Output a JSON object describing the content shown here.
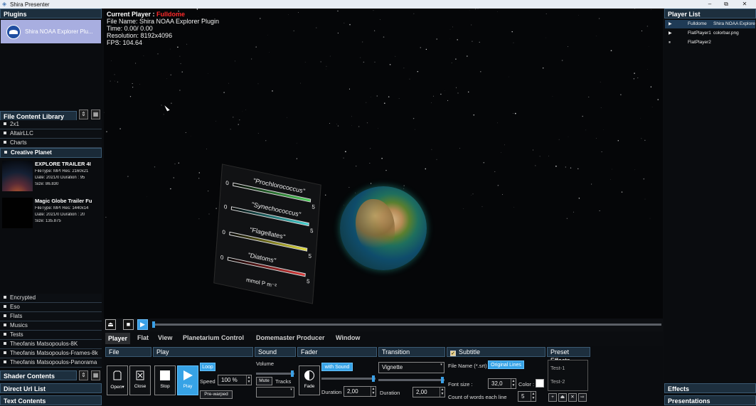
{
  "window": {
    "title": "Shira Presenter",
    "min": "–",
    "max": "⧉",
    "close": "✕"
  },
  "plugins": {
    "header": "Plugins",
    "item": "Shira NOAA Explorer Plu..."
  },
  "library": {
    "header": "File Content Library",
    "folders_top": [
      "2x1",
      "AltairLLC",
      "Charts"
    ],
    "open_folder": "Creative Planet",
    "media": [
      {
        "title": "EXPLORE TRAILER 4I",
        "type": "FileType: MPI Res: 2160x21",
        "date": "Date: 2021/0 Duration : 95",
        "size": "Size: 86.830"
      },
      {
        "title": "Magic Globe Trailer Fu",
        "type": "FileType: MPI Res: 1440x14",
        "date": "Date: 2021/0 Duration : 20",
        "size": "Size: 135.875"
      }
    ],
    "folders_bottom": [
      "Encrypted",
      "Eso",
      "Flats",
      "Musics",
      "Tests",
      "Theofanis Matsopoulos-8K",
      "Theofanis Matsopoulos-Frames-8k",
      "Theofanis Matsopoulos-Panorama"
    ]
  },
  "left_headers": {
    "shader": "Shader Contents",
    "direct": "Direct Url List",
    "text": "Text Contents"
  },
  "overlay": {
    "current_label": "Current Player : ",
    "current_value": "Fulldome",
    "file": "File Name: Shira NOAA Explorer Plugin",
    "time": "Time: 0.00/ 0.00",
    "resolution": "Resolution: 8192x4096",
    "fps": "FPS: 104.64"
  },
  "legend": {
    "items": [
      {
        "name": "\"Prochlorococcus\"",
        "min": "0",
        "max": "5",
        "color": "#4ed35a"
      },
      {
        "name": "\"Synechococcus\"",
        "min": "0",
        "max": "5",
        "color": "#3fd7d7"
      },
      {
        "name": "\"Flagellates\"",
        "min": "0",
        "max": "5",
        "color": "#e6e03a"
      },
      {
        "name": "\"Diatoms\"",
        "min": "0",
        "max": "5",
        "color": "#e13a3a"
      }
    ],
    "units": "mmol P m⁻²"
  },
  "menu": [
    "Player",
    "Flat",
    "View",
    "Planetarium Control",
    "Domemaster Producer",
    "Window"
  ],
  "sections": {
    "file": "File",
    "play": "Play",
    "sound": "Sound",
    "fader": "Fader",
    "transition": "Transition",
    "subtitle": "Subtitle",
    "preset": "Preset Effects"
  },
  "controls": {
    "open": "Open",
    "close": "Close",
    "stop": "Stop",
    "play": "Play",
    "loop": "Loop",
    "speed_label": "Speed",
    "speed_value": "100 %",
    "prewarped": "Pre-warped",
    "volume": "Volume",
    "mute": "Mute",
    "tracks": "Tracks",
    "fade": "Fade",
    "with_sound": "with Sound",
    "fader_duration_label": "Duration",
    "fader_duration": "2,00",
    "transition_value": "Vignette",
    "transition_duration_label": "Duration",
    "transition_duration": "2,00",
    "file_name_label": "File Name (*.srt)",
    "original_lines": "Original Lines",
    "font_size_label": "Font size :",
    "font_size": "32,0",
    "color_label": "Color :",
    "words_label": "Count of words each line",
    "words_value": "5",
    "preset_items": [
      "Test-1",
      "Test-2"
    ],
    "preset_buttons": [
      "+",
      "⏏",
      "✕",
      "⇨"
    ]
  },
  "player_list": {
    "header": "Player List",
    "rows": [
      {
        "icon": "▶",
        "name": "Fulldome",
        "file": "Shira NOAA Explore"
      },
      {
        "icon": "▶",
        "name": "FlatPlayer1",
        "file": "colorbar.png"
      },
      {
        "icon": "⏸",
        "name": "FlatPlayer2",
        "file": ""
      }
    ]
  },
  "right_headers": {
    "effects": "Effects",
    "presentations": "Presentations"
  }
}
